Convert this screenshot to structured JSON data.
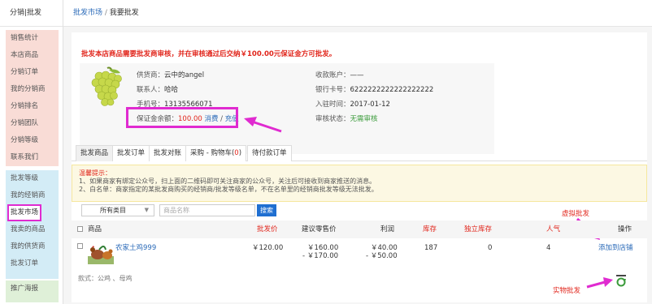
{
  "sidebar": {
    "header": "分销|批发",
    "group1": [
      "销售统计",
      "本店商品",
      "分销订单",
      "我的分销商",
      "分销排名",
      "分销团队",
      "分销等级",
      "联系我们"
    ],
    "group2": [
      "批发等级",
      "我的经销商",
      "批发市场",
      "我卖的商品",
      "我的供货商",
      "批发订单"
    ],
    "group3": [
      "推广海报"
    ]
  },
  "breadcrumb": {
    "link": "批发市场",
    "separator": " / ",
    "current": "我要批发"
  },
  "notice": "批发本店商品需要批发商审核，并在审核通过后交纳￥100.00元保证金方可批发。",
  "supplier": {
    "supplier_label": "供货商：",
    "supplier_name": "云中的angel",
    "contact_label": "联系人：",
    "contact_name": "哈哈",
    "phone_label": "手机号：",
    "phone": "13135566071",
    "deposit_label": "保证金余额：",
    "deposit_amount": "100.00",
    "deposit_refund": "消费",
    "deposit_sep": " / ",
    "deposit_recharge": "充值",
    "account_label": "收款账户：",
    "account_value": "——",
    "card_label": "银行卡号：",
    "card_value": "6222222222222222222",
    "join_label": "入驻时间：",
    "join_value": "2017-01-12",
    "audit_label": "审核状态：",
    "audit_value": "无需审核"
  },
  "tabs": [
    {
      "label": "批发商品"
    },
    {
      "label": "批发订单"
    },
    {
      "label": "批发对账"
    },
    {
      "label": "采购 - 购物车(",
      "count": "0",
      "suffix": ")"
    },
    {
      "label": "待付款订单"
    }
  ],
  "tips": {
    "title": "温馨提示：",
    "line1": "1、如果商家有绑定公众号，扫上面的二维码即可关注商家的公众号，关注后可接收到商家推送的消息。",
    "line2": "2、白名单：商家指定的某批发商购买的经销商/批发等级名单，不在名单里的经销商批发等级无法批发。"
  },
  "filter": {
    "category": "所有类目",
    "placeholder": "商品名称",
    "search": "搜索"
  },
  "annotations": {
    "virtual": "虚拟批发",
    "physical": "实物批发"
  },
  "table": {
    "headers": {
      "goods": "商品",
      "wholesale": "批发价",
      "retail": "建议零售价",
      "profit": "利润",
      "stock": "库存",
      "own_stock": "独立库存",
      "popularity": "人气",
      "action": "操作"
    },
    "rows": [
      {
        "name": "农家土鸡999",
        "wholesale": "￥120.00",
        "retail1": "￥160.00",
        "retail2": "- ￥170.00",
        "profit1": "￥40.00",
        "profit2": "- ￥50.00",
        "stock": "187",
        "own_stock": "0",
        "popularity": "4",
        "action": "添加到店铺",
        "spec": "款式：公鸡 、母鸡"
      }
    ]
  },
  "colors": {
    "accent_red": "#e1251b",
    "link_blue": "#2a6ab8",
    "highlight_magenta": "#e02bd0"
  }
}
